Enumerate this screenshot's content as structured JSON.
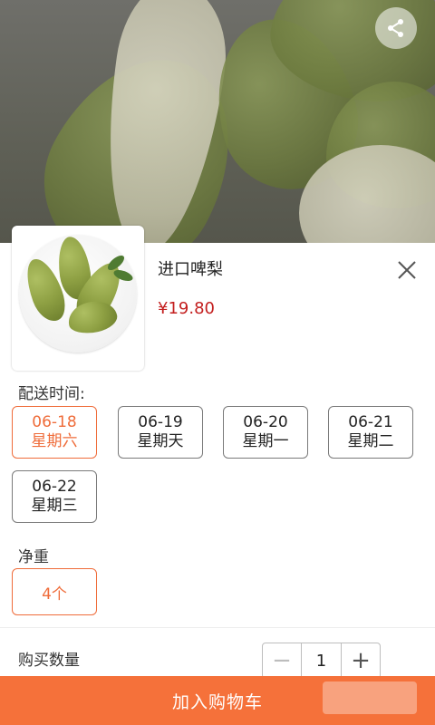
{
  "product": {
    "name": "进口啤梨",
    "price": "¥19.80"
  },
  "delivery": {
    "label": "配送时间:",
    "options": [
      {
        "date": "06-18",
        "weekday": "星期六",
        "selected": true
      },
      {
        "date": "06-19",
        "weekday": "星期天",
        "selected": false
      },
      {
        "date": "06-20",
        "weekday": "星期一",
        "selected": false
      },
      {
        "date": "06-21",
        "weekday": "星期二",
        "selected": false
      },
      {
        "date": "06-22",
        "weekday": "星期三",
        "selected": false
      }
    ]
  },
  "weight": {
    "label": "净重",
    "option": "4个"
  },
  "quantity": {
    "label": "购买数量",
    "value": "1",
    "minus": "−",
    "plus": "+"
  },
  "actions": {
    "add_to_cart": "加入购物车"
  },
  "icons": {
    "share": "share-icon",
    "close": "close-icon"
  },
  "colors": {
    "accent": "#f5713a",
    "selected_border": "#ef6c3a",
    "price": "#c31e1e"
  }
}
